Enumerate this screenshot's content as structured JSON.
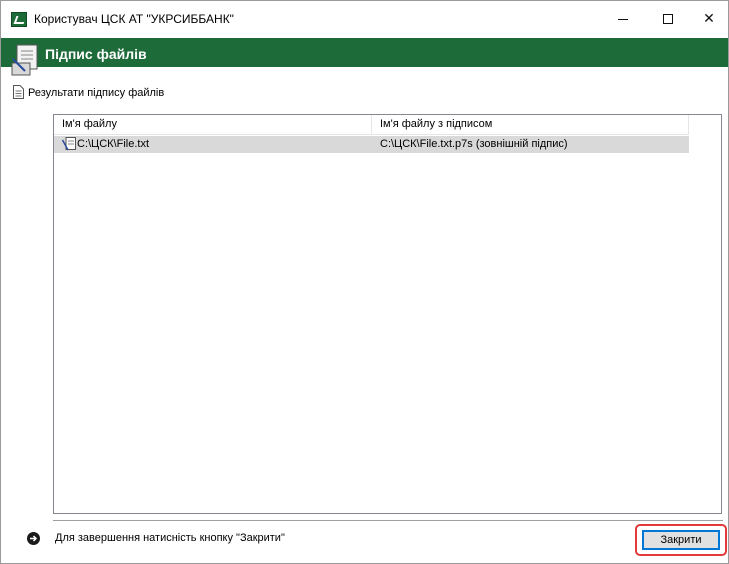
{
  "window": {
    "title": "Користувач ЦСК АТ \"УКРСИББАНК\"",
    "controls": {
      "minimize": "—",
      "maximize": "☐",
      "close": "✕"
    }
  },
  "header": {
    "title": "Підпис файлів",
    "accent_color": "#1e6b3a"
  },
  "section": {
    "label": "Результати підпису файлів"
  },
  "table": {
    "columns": [
      "Ім'я файлу",
      "Ім'я файлу з підписом"
    ],
    "rows": [
      {
        "file": "C:\\ЦСК\\File.txt",
        "signed_file": "C:\\ЦСК\\File.txt.p7s (зовнішній підпис)",
        "selected": true
      }
    ]
  },
  "footer": {
    "info_text": "Для завершення натисність кнопку \"Закрити\"",
    "close_button": "Закрити",
    "highlight_color": "#e03a3a"
  }
}
